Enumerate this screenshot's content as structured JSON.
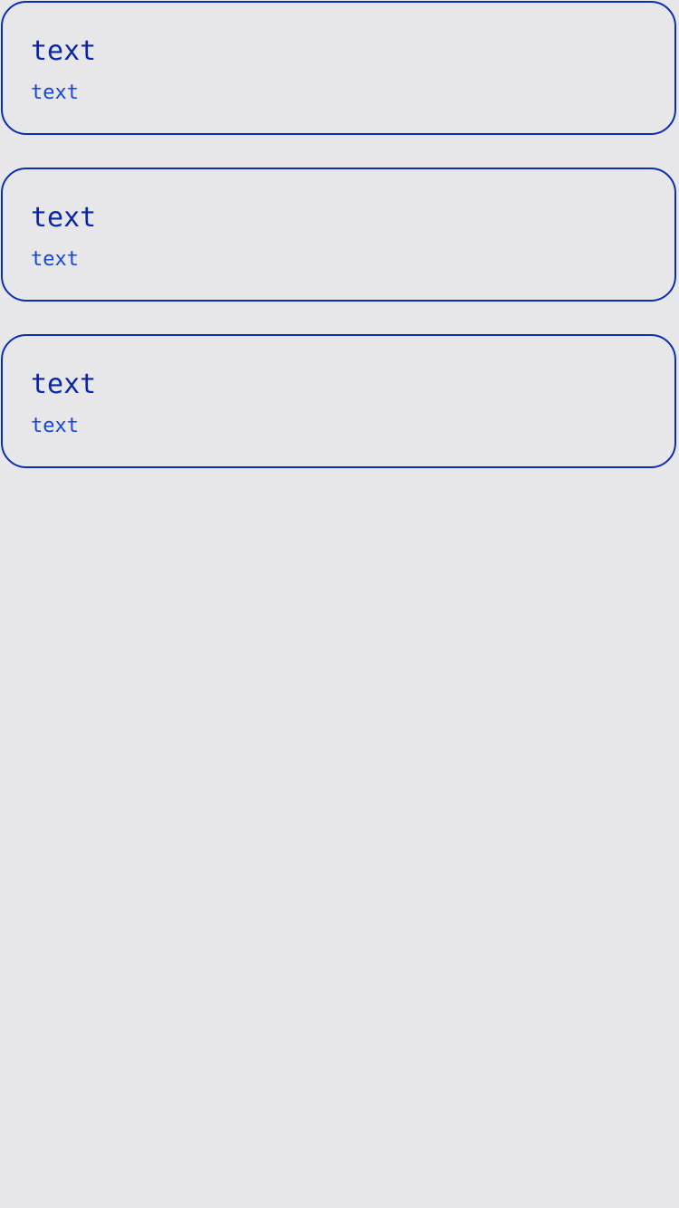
{
  "cards": [
    {
      "title": "text",
      "subtitle": "text"
    },
    {
      "title": "text",
      "subtitle": "text"
    },
    {
      "title": "text",
      "subtitle": "text"
    }
  ]
}
